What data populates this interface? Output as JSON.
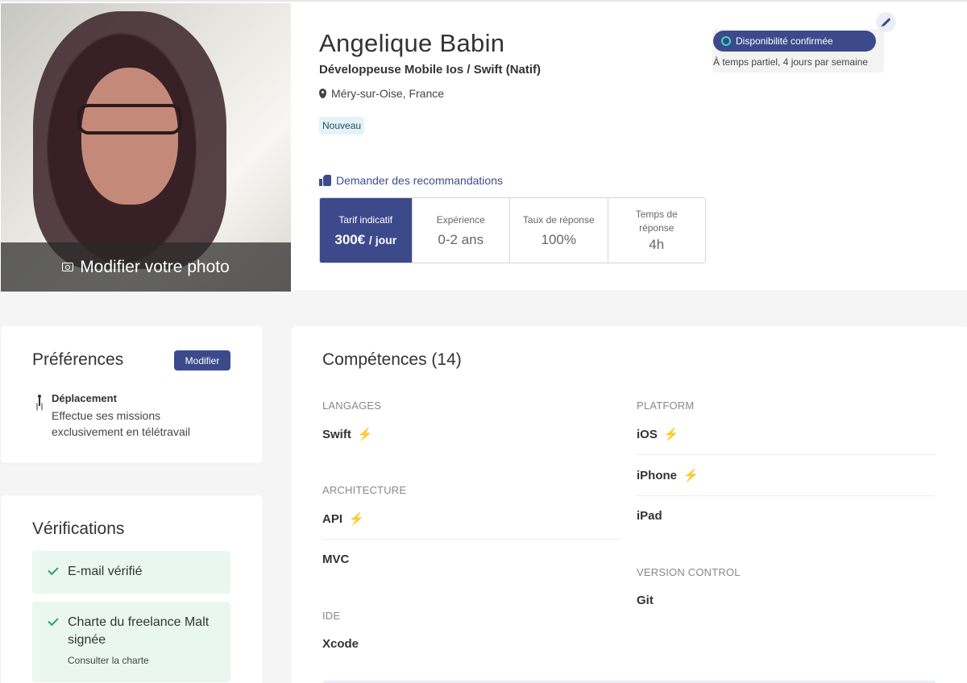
{
  "profile": {
    "name": "Angelique Babin",
    "job_title": "Développeuse Mobile Ios / Swift (Natif)",
    "location": "Méry-sur-Oise, France",
    "badge": "Nouveau",
    "photo_action": "Modifier votre photo",
    "recommendations_link": "Demander des recommandations"
  },
  "availability": {
    "status": "Disponibilité confirmée",
    "detail": "À temps partiel, 4 jours par semaine",
    "accent_color": "#3ed7c0"
  },
  "stats": [
    {
      "label": "Tarif indicatif",
      "value": "300€",
      "unit": "/ jour"
    },
    {
      "label": "Expérience",
      "value": "0-2 ans"
    },
    {
      "label": "Taux de réponse",
      "value": "100%"
    },
    {
      "label": "Temps de réponse",
      "value": "4h"
    }
  ],
  "preferences": {
    "title": "Préférences",
    "edit_label": "Modifier",
    "travel_heading": "Déplacement",
    "travel_text": "Effectue ses missions exclusivement en télétravail"
  },
  "verifications": {
    "title": "Vérifications",
    "items": [
      {
        "label": "E-mail vérifié"
      },
      {
        "label": "Charte du freelance Malt signée",
        "link": "Consulter la charte"
      }
    ]
  },
  "skills": {
    "title": "Compétences (14)",
    "left": [
      {
        "category": "LANGAGES",
        "items": [
          {
            "name": "Swift",
            "star": true
          }
        ]
      },
      {
        "category": "ARCHITECTURE",
        "items": [
          {
            "name": "API",
            "star": true
          },
          {
            "name": "MVC",
            "star": false
          }
        ]
      },
      {
        "category": "IDE",
        "items": [
          {
            "name": "Xcode",
            "star": false
          }
        ]
      }
    ],
    "right": [
      {
        "category": "PLATFORM",
        "items": [
          {
            "name": "iOS",
            "star": true
          },
          {
            "name": "iPhone",
            "star": true
          },
          {
            "name": "iPad",
            "star": false
          }
        ]
      },
      {
        "category": "VERSION CONTROL",
        "items": [
          {
            "name": "Git",
            "star": false
          }
        ]
      }
    ]
  },
  "colors": {
    "brand": "#3c4a8c",
    "verified_bg": "#eaf7f1",
    "bolt": "#f6b21b"
  }
}
